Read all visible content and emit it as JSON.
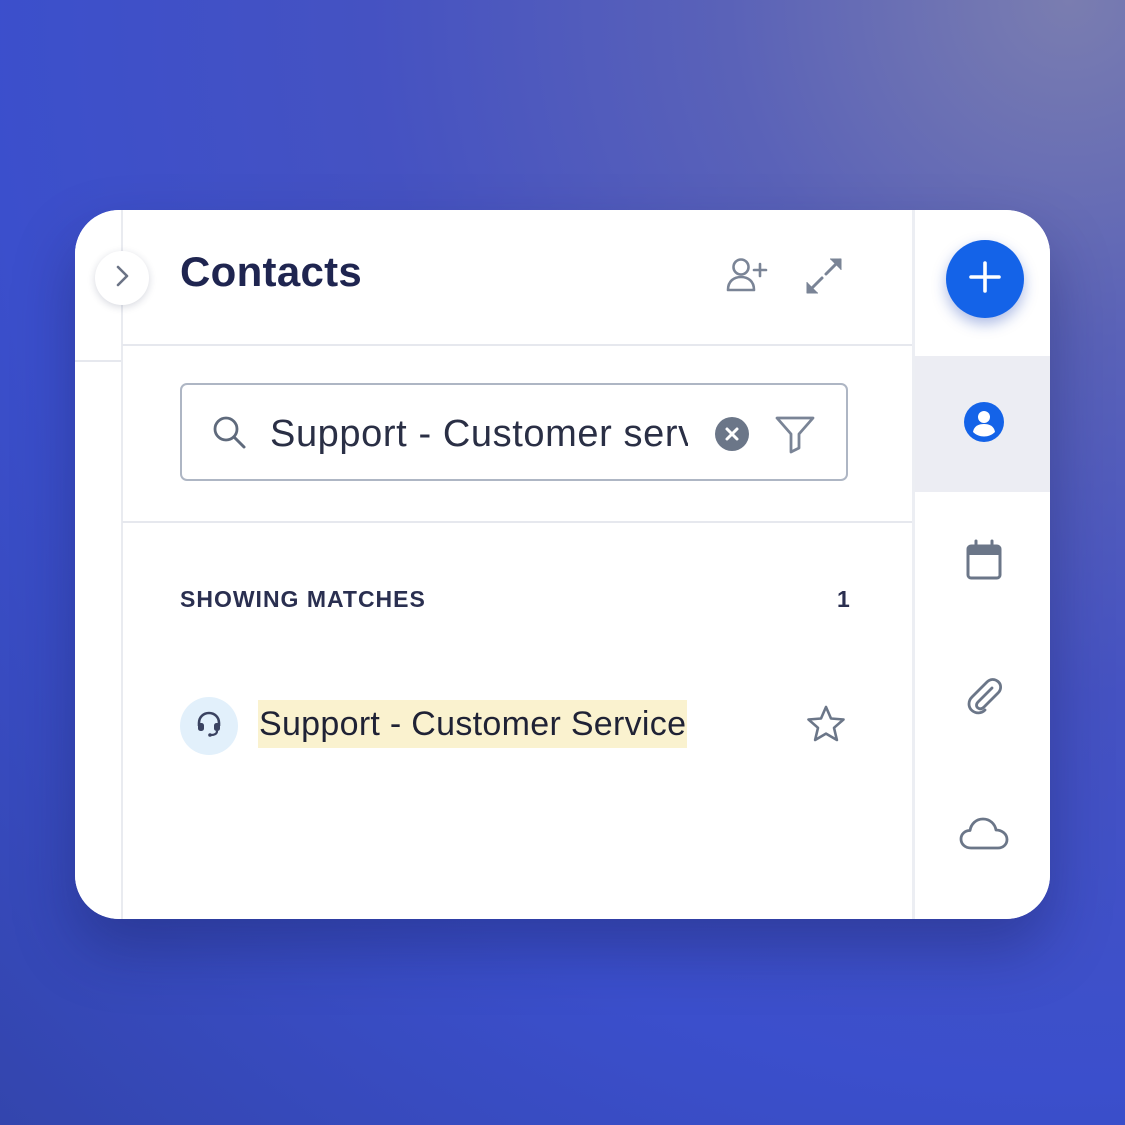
{
  "colors": {
    "accent": "#1463e8",
    "title_text": "#1f2550",
    "highlight": "#faf2cf",
    "icon_gray": "#7a8496",
    "avatar_bg": "#e2f0fb"
  },
  "panel": {
    "title": "Contacts",
    "header_actions": [
      {
        "icon": "add-contact-icon"
      },
      {
        "icon": "expand-arrows-icon"
      }
    ],
    "collapse_toggle_icon": "chevron-right-icon"
  },
  "search": {
    "value": "Support - Customer service",
    "icon": "search-icon",
    "clear_icon": "clear-circle-icon",
    "filter_icon": "filter-icon"
  },
  "results": {
    "label": "SHOWING MATCHES",
    "count": "1",
    "items": [
      {
        "name": "Support - Customer Service",
        "avatar_icon": "headset-icon",
        "starred": false
      }
    ]
  },
  "rail": {
    "fab_icon": "plus-icon",
    "items": [
      {
        "icon": "contact-person-icon",
        "active": true
      },
      {
        "icon": "calendar-icon",
        "active": false
      },
      {
        "icon": "paperclip-icon",
        "active": false
      },
      {
        "icon": "cloud-icon",
        "active": false
      }
    ]
  }
}
